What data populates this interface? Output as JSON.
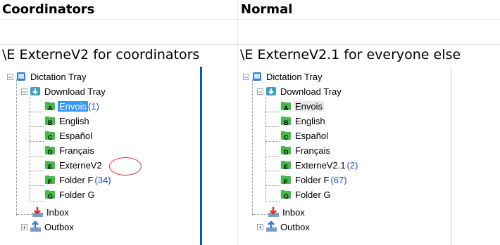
{
  "headers": {
    "left": "Coordinators",
    "right": "Normal"
  },
  "subtitles": {
    "left": "\\E ExterneV2 for coordinators",
    "right": "\\E ExterneV2.1 for everyone else"
  },
  "left_tree": {
    "root": "Dictation Tray",
    "download": "Download Tray",
    "items": [
      {
        "letter": "A",
        "label": "Envois",
        "count": "(1)"
      },
      {
        "letter": "B",
        "label": "English",
        "count": ""
      },
      {
        "letter": "C",
        "label": "Español",
        "count": ""
      },
      {
        "letter": "D",
        "label": "Français",
        "count": ""
      },
      {
        "letter": "E",
        "label": "ExterneV2",
        "count": ""
      },
      {
        "letter": "F",
        "label": "Folder F",
        "count": "(34)"
      },
      {
        "letter": "G",
        "label": "Folder G",
        "count": ""
      }
    ],
    "inbox": "Inbox",
    "outbox": "Outbox"
  },
  "right_tree": {
    "root": "Dictation Tray",
    "download": "Download Tray",
    "items": [
      {
        "letter": "A",
        "label": "Envois",
        "count": ""
      },
      {
        "letter": "B",
        "label": "English",
        "count": ""
      },
      {
        "letter": "C",
        "label": "Español",
        "count": ""
      },
      {
        "letter": "D",
        "label": "Français",
        "count": ""
      },
      {
        "letter": "E",
        "label": "ExterneV2.1",
        "count": "(2)"
      },
      {
        "letter": "F",
        "label": "Folder F",
        "count": "(67)"
      },
      {
        "letter": "G",
        "label": "Folder G",
        "count": ""
      }
    ],
    "inbox": "Inbox",
    "outbox": "Outbox"
  }
}
